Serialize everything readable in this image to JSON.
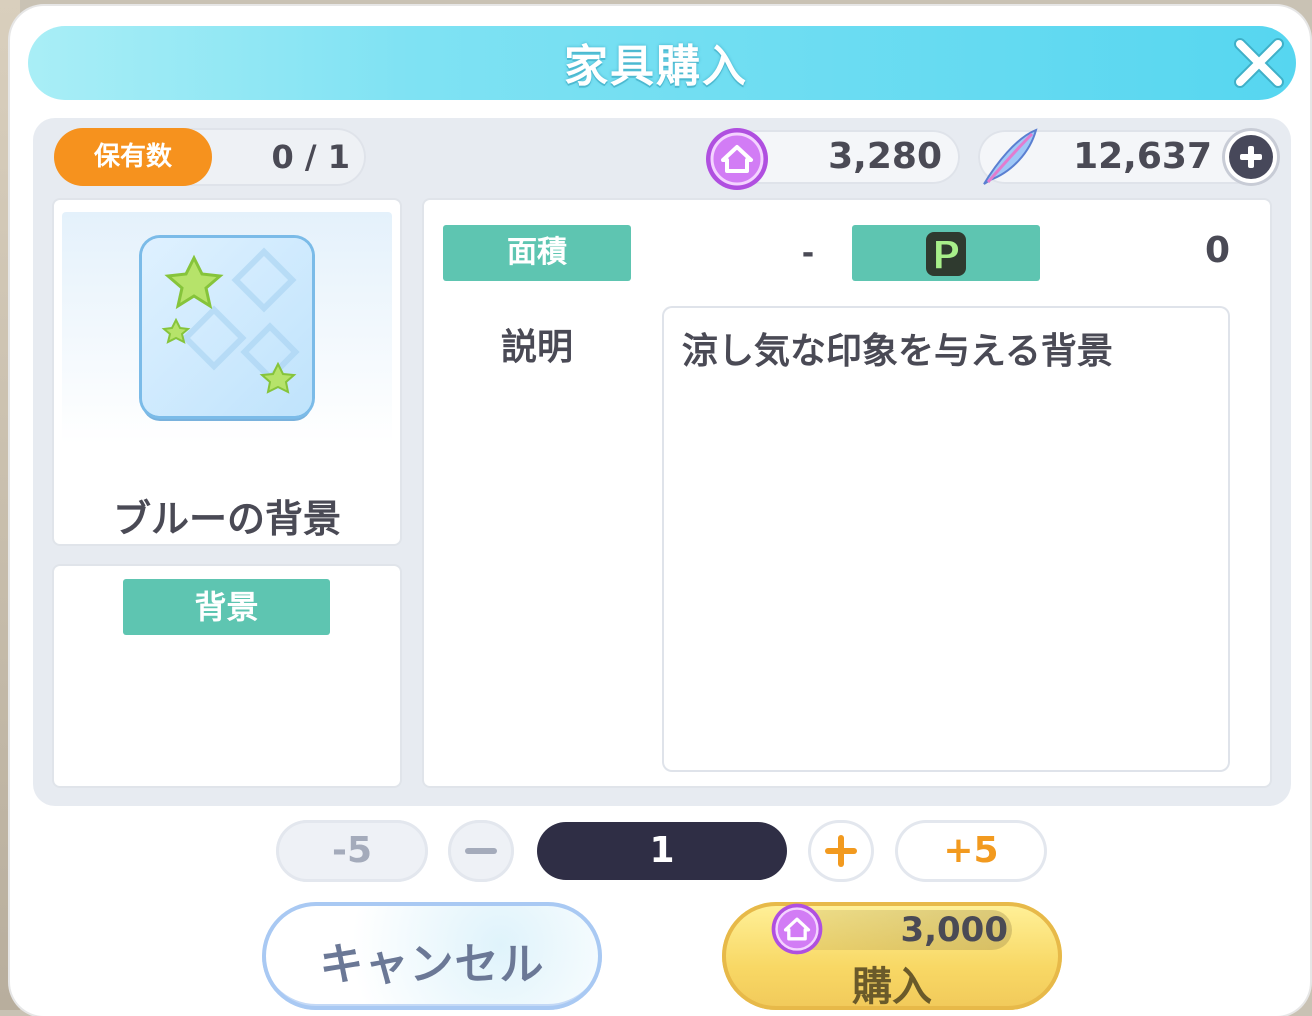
{
  "dialog": {
    "title": "家具購入",
    "close_icon": "close-icon"
  },
  "header": {
    "owned_label": "保有数",
    "owned_value": "0 / 1",
    "house_coin_value": "3,280",
    "feather_value": "12,637"
  },
  "item": {
    "name": "ブルーの背景",
    "category": "背景",
    "area_label": "面積",
    "area_value": "-",
    "point_icon": "P",
    "point_value": "0",
    "description_label": "説明",
    "description": "涼し気な印象を与える背景"
  },
  "quantity": {
    "minus5": "-5",
    "minus": "−",
    "value": "1",
    "plus": "+",
    "plus5": "+5"
  },
  "actions": {
    "cancel_label": "キャンセル",
    "buy_label": "購入",
    "buy_price": "3,000"
  },
  "colors": {
    "title_bar": "#56d6f0",
    "owned_badge": "#f6921e",
    "teal_badge": "#5ec5b1",
    "quantity_pill": "#2f2e45",
    "buy_button": "#f8d865",
    "accent_orange": "#f29a1f"
  }
}
